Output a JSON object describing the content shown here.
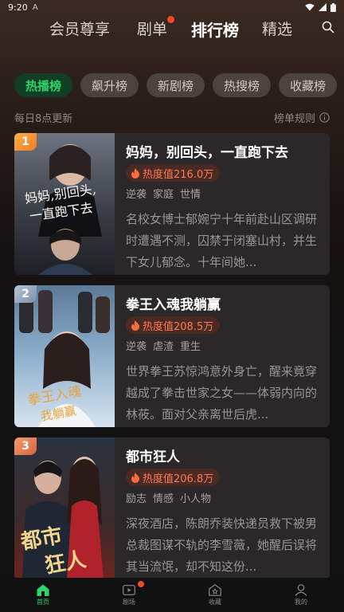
{
  "status": {
    "time": "9:20",
    "indicator": "A"
  },
  "top_nav": {
    "tabs": [
      {
        "label": "会员尊享",
        "active": false
      },
      {
        "label": "剧单",
        "active": false,
        "dot": true
      },
      {
        "label": "排行榜",
        "active": true
      },
      {
        "label": "精选",
        "active": false
      }
    ],
    "search_icon": "search-icon"
  },
  "chips": [
    "热播榜",
    "飙升榜",
    "新剧榜",
    "热搜榜",
    "收藏榜"
  ],
  "active_chip": 0,
  "subheader": {
    "update_text": "每日8点更新",
    "rules_text": "榜单规则",
    "rules_icon": "info-icon"
  },
  "list": [
    {
      "rank": "1",
      "title": "妈妈，别回头，一直跑下去",
      "heat": "热度值216.0万",
      "tags": [
        "逆袭",
        "家庭",
        "世情"
      ],
      "desc": "名校女博士郁婉宁十年前赴山区调研时遭遇不测，囚禁于闭塞山村，并生下女儿郁念。十年间她..."
    },
    {
      "rank": "2",
      "title": "拳王入魂我躺赢",
      "heat": "热度值208.5万",
      "tags": [
        "逆袭",
        "虐渣",
        "重生"
      ],
      "desc": "世界拳王苏惊鸿意外身亡，醒来竟穿越成了拳击世家之女——体弱内向的林莜。面对父亲离世后虎..."
    },
    {
      "rank": "3",
      "title": "都市狂人",
      "heat": "热度值206.8万",
      "tags": [
        "励志",
        "情感",
        "小人物"
      ],
      "desc": "深夜酒店，陈朗乔装快递员救下被男总裁图谋不轨的李雪薇，她醒后误将其当流氓，却不知这份..."
    }
  ],
  "bottom_nav": [
    {
      "label": "首页",
      "icon": "home-icon",
      "active": true
    },
    {
      "label": "剧场",
      "icon": "theater-icon",
      "active": false,
      "dot": true
    },
    {
      "label": "收藏",
      "icon": "collect-icon",
      "active": false
    },
    {
      "label": "我的",
      "icon": "profile-icon",
      "active": false
    }
  ],
  "colors": {
    "accent": "#2fd36b",
    "heat": "#ff7a52",
    "dot": "#f04a2a"
  }
}
